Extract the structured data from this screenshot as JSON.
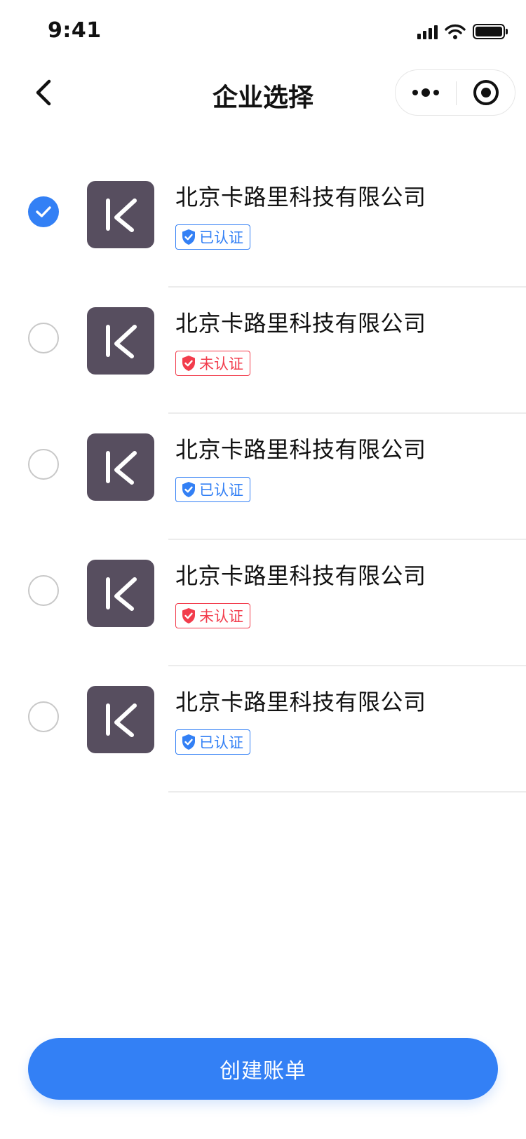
{
  "status_bar": {
    "time": "9:41"
  },
  "nav": {
    "title": "企业选择"
  },
  "companies": [
    {
      "name": "北京卡路里科技有限公司",
      "status": "已认证",
      "verified": true,
      "selected": true
    },
    {
      "name": "北京卡路里科技有限公司",
      "status": "未认证",
      "verified": false,
      "selected": false
    },
    {
      "name": "北京卡路里科技有限公司",
      "status": "已认证",
      "verified": true,
      "selected": false
    },
    {
      "name": "北京卡路里科技有限公司",
      "status": "未认证",
      "verified": false,
      "selected": false
    },
    {
      "name": "北京卡路里科技有限公司",
      "status": "已认证",
      "verified": true,
      "selected": false
    }
  ],
  "primary_button": {
    "label": "创建账单"
  },
  "colors": {
    "accent": "#3380f5",
    "danger": "#f23c4c",
    "logo_bg": "#574e5f",
    "divider": "#ececec"
  },
  "icons": {
    "back": "chevron-left-icon",
    "more": "more-dots-icon",
    "close": "target-circle-icon",
    "check": "check-icon",
    "shield": "shield-check-icon",
    "logo": "keep-k-logo"
  }
}
